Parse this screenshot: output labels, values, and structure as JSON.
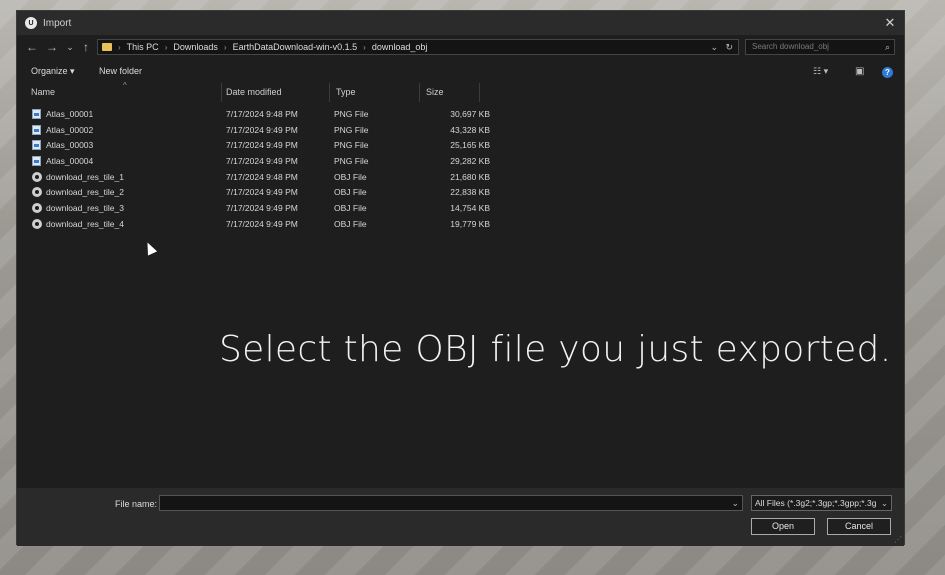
{
  "window": {
    "title": "Import",
    "close_glyph": "✕"
  },
  "nav": {
    "back_glyph": "←",
    "forward_glyph": "→",
    "recent_glyph": "⌄",
    "up_glyph": "↑",
    "breadcrumbs": [
      "This PC",
      "Downloads",
      "EarthDataDownload-win-v0.1.5",
      "download_obj"
    ],
    "separator": "›",
    "dropdown_glyph": "⌄",
    "refresh_glyph": "↻"
  },
  "search": {
    "placeholder": "Search download_obj",
    "icon": "⌕"
  },
  "toolbar": {
    "organize_label": "Organize ▾",
    "new_folder_label": "New folder",
    "view_glyph": "☷ ▾",
    "pane_glyph": "▣",
    "help_glyph": "?"
  },
  "columns": {
    "name": "Name",
    "date": "Date modified",
    "type": "Type",
    "size": "Size",
    "sort_glyph": "^"
  },
  "files": [
    {
      "name": "Atlas_00001",
      "date": "7/17/2024 9:48 PM",
      "type": "PNG File",
      "size": "30,697 KB",
      "icon": "png-icon"
    },
    {
      "name": "Atlas_00002",
      "date": "7/17/2024 9:49 PM",
      "type": "PNG File",
      "size": "43,328 KB",
      "icon": "png-icon"
    },
    {
      "name": "Atlas_00003",
      "date": "7/17/2024 9:49 PM",
      "type": "PNG File",
      "size": "25,165 KB",
      "icon": "png-icon"
    },
    {
      "name": "Atlas_00004",
      "date": "7/17/2024 9:49 PM",
      "type": "PNG File",
      "size": "29,282 KB",
      "icon": "png-icon"
    },
    {
      "name": "download_res_tile_1",
      "date": "7/17/2024 9:48 PM",
      "type": "OBJ File",
      "size": "21,680 KB",
      "icon": "obj-icon"
    },
    {
      "name": "download_res_tile_2",
      "date": "7/17/2024 9:49 PM",
      "type": "OBJ File",
      "size": "22,838 KB",
      "icon": "obj-icon"
    },
    {
      "name": "download_res_tile_3",
      "date": "7/17/2024 9:49 PM",
      "type": "OBJ File",
      "size": "14,754 KB",
      "icon": "obj-icon"
    },
    {
      "name": "download_res_tile_4",
      "date": "7/17/2024 9:49 PM",
      "type": "OBJ File",
      "size": "19,779 KB",
      "icon": "obj-icon"
    }
  ],
  "caption": "Select the OBJ file you just exported.",
  "bottom": {
    "file_name_label": "File name:",
    "file_name_value": "",
    "dropdown_glyph": "⌄",
    "filter_value": "All Files (*.3g2;*.3gp;*.3gpp;*.3g",
    "open_label": "Open",
    "cancel_label": "Cancel",
    "grip_glyph": "⋰"
  },
  "colors": {
    "dialog_bg": "#1e1e1e",
    "folder": "#e8c15a",
    "help": "#2e7bd6"
  }
}
